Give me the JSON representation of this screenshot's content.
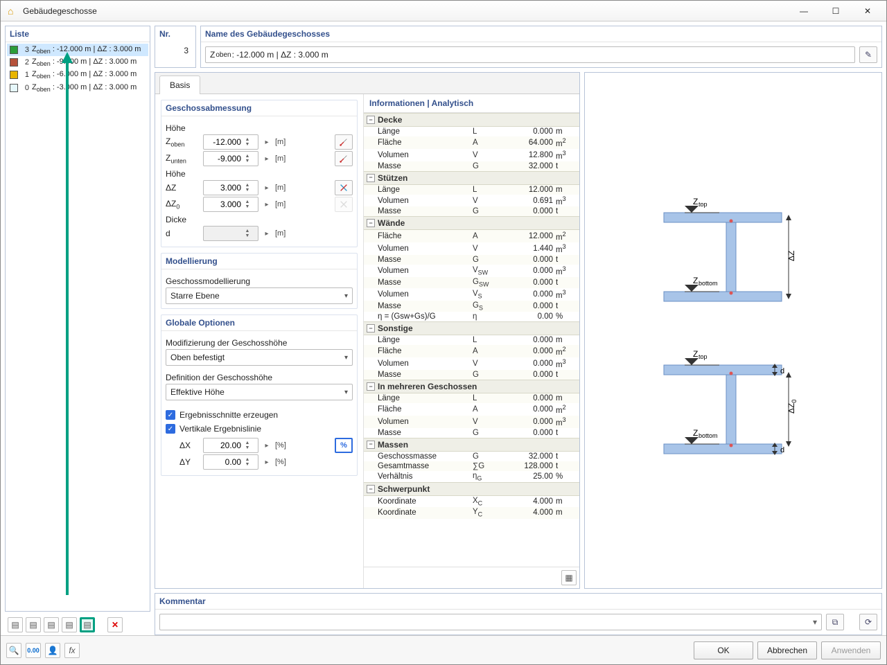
{
  "window": {
    "title": "Gebäudegeschosse"
  },
  "listPanel": {
    "title": "Liste",
    "items": [
      {
        "idx": 3,
        "color": "#2a9d3a",
        "label_prefix": "Z",
        "label_sub": "oben",
        "label_rest": " : -12.000 m | ΔZ : 3.000 m",
        "selected": true
      },
      {
        "idx": 2,
        "color": "#b5513a",
        "label_prefix": "Z",
        "label_sub": "oben",
        "label_rest": " : -9.000 m | ΔZ : 3.000 m",
        "selected": false
      },
      {
        "idx": 1,
        "color": "#e8b500",
        "label_prefix": "Z",
        "label_sub": "oben",
        "label_rest": " : -6.000 m | ΔZ : 3.000 m",
        "selected": false
      },
      {
        "idx": 0,
        "color": "#e6f7fb",
        "label_prefix": "Z",
        "label_sub": "oben",
        "label_rest": " : -3.000 m | ΔZ : 3.000 m",
        "selected": false
      }
    ]
  },
  "nr": {
    "title": "Nr.",
    "value": "3"
  },
  "nameBox": {
    "title": "Name des Gebäudegeschosses",
    "value_prefix": "Z",
    "value_sub": "oben",
    "value_rest": " : -12.000 m | ΔZ : 3.000 m"
  },
  "tabs": {
    "basis": "Basis"
  },
  "dims": {
    "title": "Geschossabmessung",
    "hohe": "Höhe",
    "zoben_lbl": "Z",
    "zoben_sub": "oben",
    "zoben_val": "-12.000",
    "zoben_unit": "[m]",
    "zunten_lbl": "Z",
    "zunten_sub": "unten",
    "zunten_val": "-9.000",
    "zunten_unit": "[m]",
    "hohe2": "Höhe",
    "dz_lbl": "ΔZ",
    "dz_val": "3.000",
    "dz_unit": "[m]",
    "dz0_lbl": "ΔZ",
    "dz0_sub": "0",
    "dz0_val": "3.000",
    "dz0_unit": "[m]",
    "dicke": "Dicke",
    "d_lbl": "d",
    "d_unit": "[m]"
  },
  "model": {
    "title": "Modellierung",
    "label": "Geschossmodellierung",
    "value": "Starre Ebene"
  },
  "global": {
    "title": "Globale Optionen",
    "mod_label": "Modifizierung der Geschosshöhe",
    "mod_value": "Oben befestigt",
    "def_label": "Definition der Geschosshöhe",
    "def_value": "Effektive Höhe",
    "chk1": "Ergebnisschnitte erzeugen",
    "chk2": "Vertikale Ergebnislinie",
    "dx_lbl": "ΔX",
    "dx_val": "20.00",
    "dx_unit": "[%]",
    "dy_lbl": "ΔY",
    "dy_val": "0.00",
    "dy_unit": "[%]",
    "pct": "%"
  },
  "info": {
    "title": "Informationen | Analytisch",
    "sections": [
      {
        "name": "Decke",
        "rows": [
          {
            "n": "Länge",
            "s": "L",
            "v": "0.000",
            "u": "m"
          },
          {
            "n": "Fläche",
            "s": "A",
            "v": "64.000",
            "u": "m",
            "sup": "2"
          },
          {
            "n": "Volumen",
            "s": "V",
            "v": "12.800",
            "u": "m",
            "sup": "3"
          },
          {
            "n": "Masse",
            "s": "G",
            "v": "32.000",
            "u": "t"
          }
        ]
      },
      {
        "name": "Stützen",
        "rows": [
          {
            "n": "Länge",
            "s": "L",
            "v": "12.000",
            "u": "m"
          },
          {
            "n": "Volumen",
            "s": "V",
            "v": "0.691",
            "u": "m",
            "sup": "3"
          },
          {
            "n": "Masse",
            "s": "G",
            "v": "0.000",
            "u": "t"
          }
        ]
      },
      {
        "name": "Wände",
        "rows": [
          {
            "n": "Fläche",
            "s": "A",
            "v": "12.000",
            "u": "m",
            "sup": "2"
          },
          {
            "n": "Volumen",
            "s": "V",
            "v": "1.440",
            "u": "m",
            "sup": "3"
          },
          {
            "n": "Masse",
            "s": "G",
            "v": "0.000",
            "u": "t"
          },
          {
            "n": "Volumen",
            "s": "V",
            "sub": "SW",
            "v": "0.000",
            "u": "m",
            "sup": "3"
          },
          {
            "n": "Masse",
            "s": "G",
            "sub": "SW",
            "v": "0.000",
            "u": "t"
          },
          {
            "n": "Volumen",
            "s": "V",
            "sub": "S",
            "v": "0.000",
            "u": "m",
            "sup": "3"
          },
          {
            "n": "Masse",
            "s": "G",
            "sub": "S",
            "v": "0.000",
            "u": "t"
          },
          {
            "n": "η = (Gsw+Gs)/G",
            "s": "η",
            "v": "0.00",
            "u": "%"
          }
        ]
      },
      {
        "name": "Sonstige",
        "rows": [
          {
            "n": "Länge",
            "s": "L",
            "v": "0.000",
            "u": "m"
          },
          {
            "n": "Fläche",
            "s": "A",
            "v": "0.000",
            "u": "m",
            "sup": "2"
          },
          {
            "n": "Volumen",
            "s": "V",
            "v": "0.000",
            "u": "m",
            "sup": "3"
          },
          {
            "n": "Masse",
            "s": "G",
            "v": "0.000",
            "u": "t"
          }
        ]
      },
      {
        "name": "In mehreren Geschossen",
        "rows": [
          {
            "n": "Länge",
            "s": "L",
            "v": "0.000",
            "u": "m"
          },
          {
            "n": "Fläche",
            "s": "A",
            "v": "0.000",
            "u": "m",
            "sup": "2"
          },
          {
            "n": "Volumen",
            "s": "V",
            "v": "0.000",
            "u": "m",
            "sup": "3"
          },
          {
            "n": "Masse",
            "s": "G",
            "v": "0.000",
            "u": "t"
          }
        ]
      },
      {
        "name": "Massen",
        "rows": [
          {
            "n": "Geschossmasse",
            "s": "G",
            "v": "32.000",
            "u": "t"
          },
          {
            "n": "Gesamtmasse",
            "s": "∑G",
            "v": "128.000",
            "u": "t"
          },
          {
            "n": "Verhältnis",
            "s": "η",
            "sub": "G",
            "v": "25.00",
            "u": "%"
          }
        ]
      },
      {
        "name": "Schwerpunkt",
        "rows": [
          {
            "n": "Koordinate",
            "s": "X",
            "sub": "C",
            "v": "4.000",
            "u": "m"
          },
          {
            "n": "Koordinate",
            "s": "Y",
            "sub": "C",
            "v": "4.000",
            "u": "m"
          }
        ]
      }
    ]
  },
  "diagram": {
    "ztop": "Z",
    "ztop_sub": "top",
    "zbot": "Z",
    "zbot_sub": "bottom",
    "dz": "ΔZ",
    "dz0": "ΔZ",
    "dz0_sub": "0",
    "d": "d"
  },
  "comment": {
    "title": "Kommentar"
  },
  "buttons": {
    "ok": "OK",
    "cancel": "Abbrechen",
    "apply": "Anwenden"
  }
}
